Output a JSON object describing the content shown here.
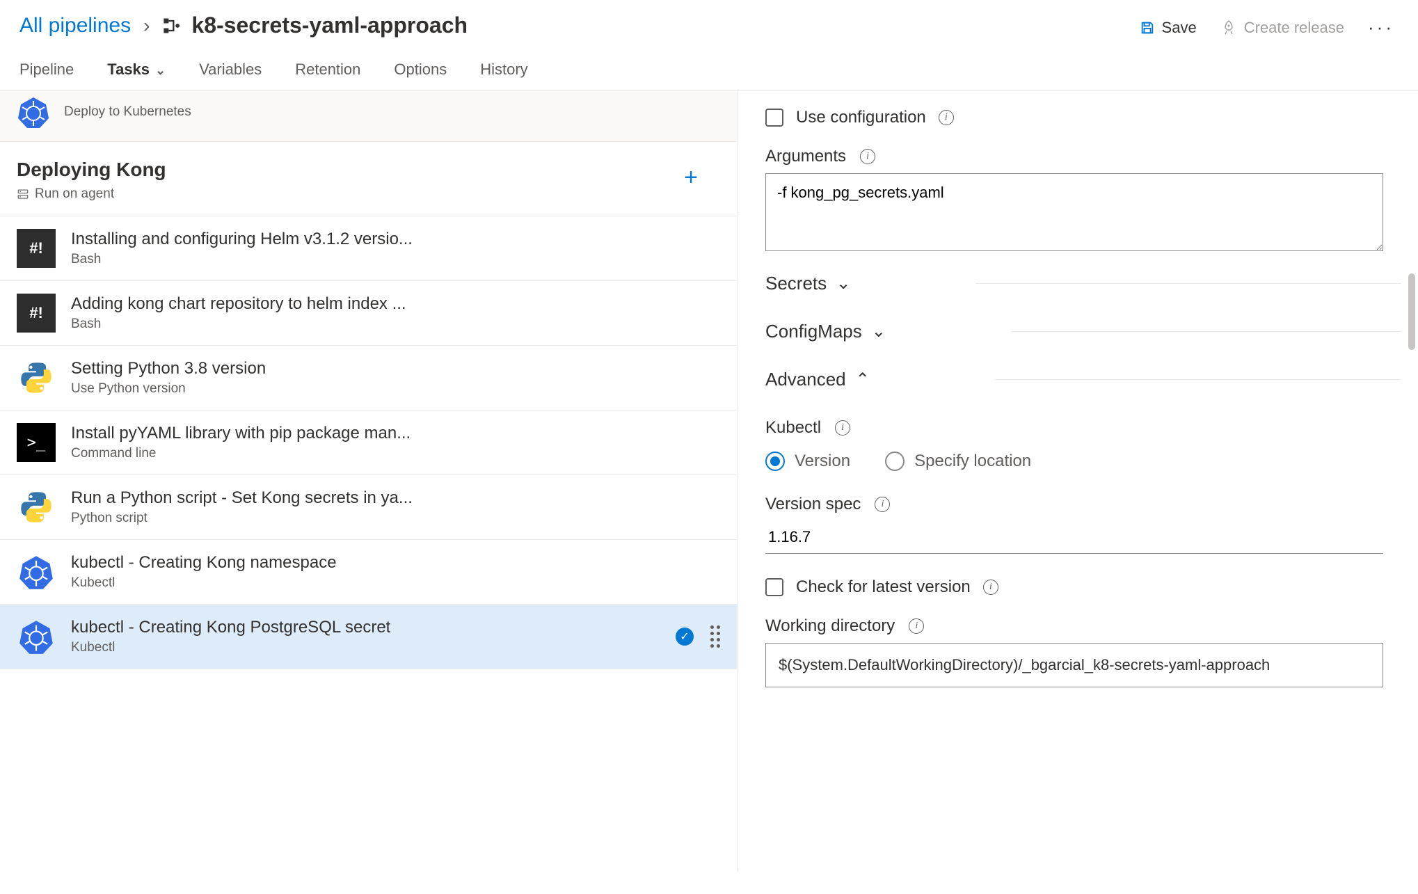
{
  "breadcrumb": {
    "root": "All pipelines",
    "title": "k8-secrets-yaml-approach"
  },
  "headerActions": {
    "save": "Save",
    "createRelease": "Create release"
  },
  "tabs": {
    "pipeline": "Pipeline",
    "tasks": "Tasks",
    "variables": "Variables",
    "retention": "Retention",
    "options": "Options",
    "history": "History"
  },
  "stagePartial": {
    "subtitle": "Deploy to Kubernetes"
  },
  "agent": {
    "title": "Deploying Kong",
    "subtitle": "Run on agent"
  },
  "tasks_list": [
    {
      "name": "Installing and configuring Helm v3.1.2 versio...",
      "type": "Bash",
      "icon": "bash"
    },
    {
      "name": "Adding kong chart repository to helm index ...",
      "type": "Bash",
      "icon": "bash"
    },
    {
      "name": "Setting Python 3.8 version",
      "type": "Use Python version",
      "icon": "python"
    },
    {
      "name": "Install pyYAML library with pip package man...",
      "type": "Command line",
      "icon": "cmd"
    },
    {
      "name": "Run a Python script - Set Kong secrets in ya...",
      "type": "Python script",
      "icon": "python"
    },
    {
      "name": "kubectl - Creating Kong namespace",
      "type": "Kubectl",
      "icon": "k8s"
    },
    {
      "name": "kubectl - Creating Kong PostgreSQL secret",
      "type": "Kubectl",
      "icon": "k8s",
      "selected": true,
      "status": "ok"
    }
  ],
  "form": {
    "useConfiguration": {
      "label": "Use configuration",
      "checked": false
    },
    "arguments": {
      "label": "Arguments",
      "value": "-f kong_pg_secrets.yaml"
    },
    "sections": {
      "secrets": "Secrets",
      "configMaps": "ConfigMaps",
      "advanced": "Advanced"
    },
    "kubectl": {
      "label": "Kubectl",
      "radio": {
        "version": "Version",
        "specify": "Specify location",
        "selected": "version"
      }
    },
    "versionSpec": {
      "label": "Version spec",
      "value": "1.16.7"
    },
    "checkLatest": {
      "label": "Check for latest version",
      "checked": false
    },
    "workingDir": {
      "label": "Working directory",
      "value": "$(System.DefaultWorkingDirectory)/_bgarcial_k8-secrets-yaml-approach"
    }
  }
}
